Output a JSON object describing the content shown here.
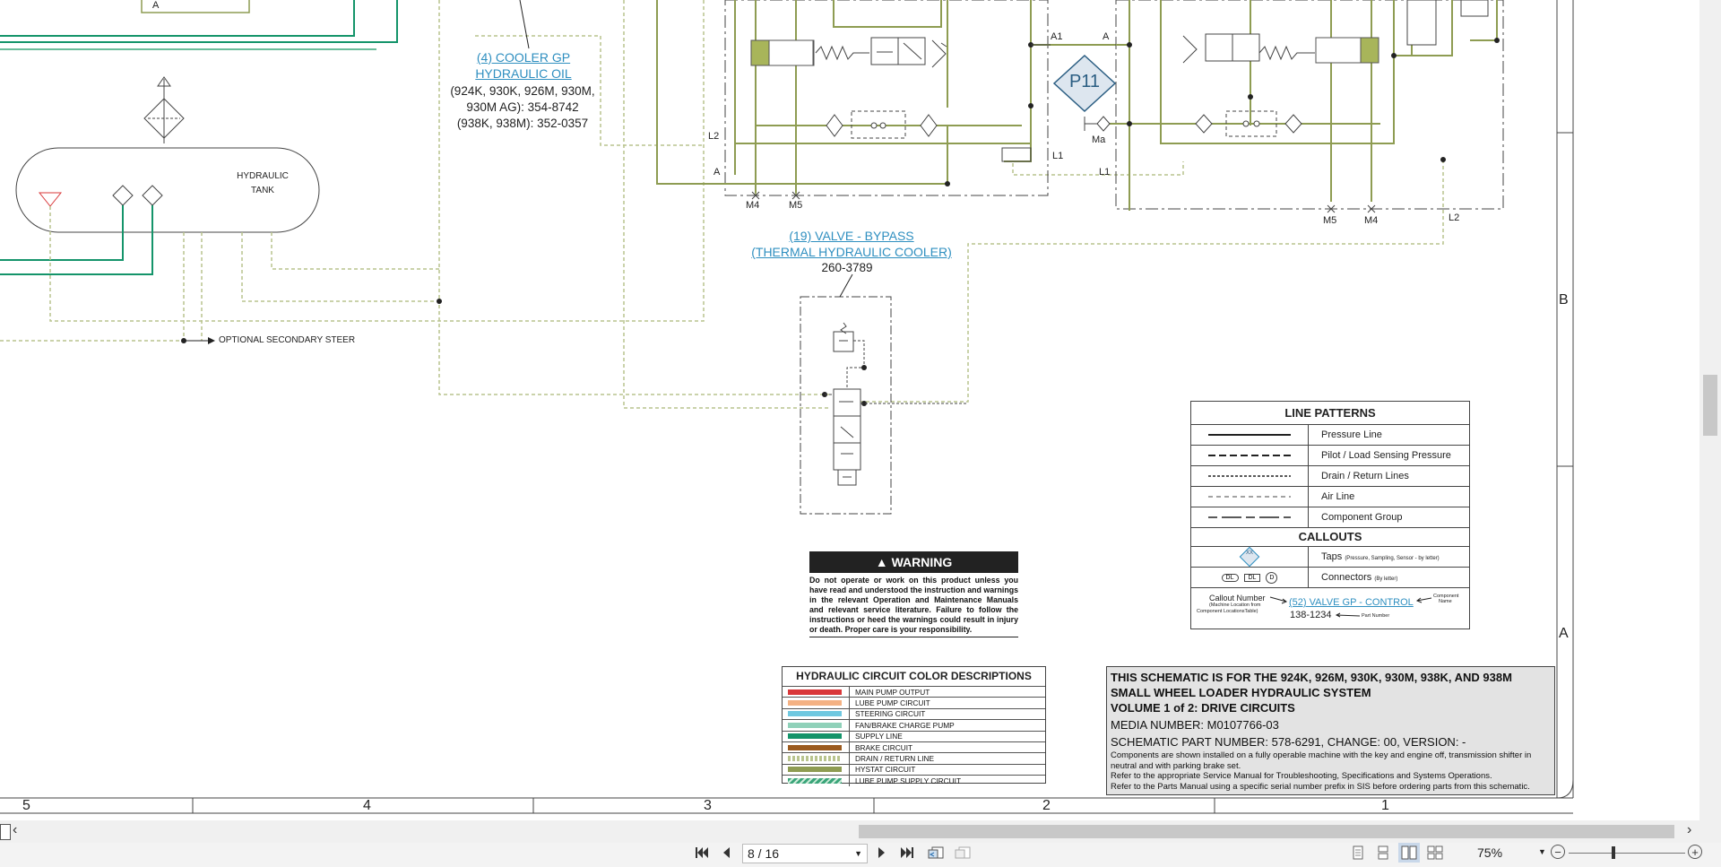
{
  "schematic": {
    "cooler": {
      "name_line1": "(4) COOLER GP",
      "name_line2": "HYDRAULIC OIL",
      "models_line1": "(924K, 930K, 926M, 930M,",
      "models_line2": "930M AG): 354-8742",
      "models_line3": "(938K, 938M): 352-0357"
    },
    "tank": {
      "line1": "HYDRAULIC",
      "line2": "TANK"
    },
    "secondary_steer": "OPTIONAL SECONDARY STEER",
    "bypass": {
      "name_line1": "(19) VALVE - BYPASS",
      "name_line2": "(THERMAL HYDRAULIC COOLER)",
      "part": "260-3789"
    },
    "port_labels": {
      "a_top_left": "A",
      "l2_left": "L2",
      "a_left": "A",
      "m4_left": "M4",
      "m5_left": "M5",
      "a1": "A1",
      "a_right": "A",
      "p11": "P11",
      "ma": "Ma",
      "l1_a": "L1",
      "l1_b": "L1",
      "m5_right": "M5",
      "m4_right": "M4",
      "l2_right": "L2"
    },
    "zones": {
      "b": "B",
      "a": "A"
    },
    "columns": [
      "5",
      "4",
      "3",
      "2",
      "1"
    ]
  },
  "warning": {
    "title": "WARNING",
    "body": "Do not operate or work on this product unless you have read and understood the instruction and warnings in the relevant Operation and Maintenance Manuals and relevant service literature. Failure to follow the instructions or heed the warnings could result in injury or death. Proper care is your responsibility."
  },
  "line_patterns": {
    "title": "LINE PATTERNS",
    "rows": [
      {
        "label": "Pressure Line"
      },
      {
        "label": "Pilot / Load Sensing Pressure"
      },
      {
        "label": "Drain / Return Lines"
      },
      {
        "label": "Air Line"
      },
      {
        "label": "Component Group"
      }
    ],
    "callouts_title": "CALLOUTS",
    "taps_label": "Taps",
    "taps_note": "(Pressure, Sampling, Sensor - by letter)",
    "connectors_label": "Connectors",
    "connectors_note": "(By letter)",
    "connector_dl1": "DL",
    "connector_dl2": "DL",
    "connector_d": "D",
    "tap_letters": "XX",
    "callout_number": "Callout Number",
    "callout_note_line1": "(Machine Location from",
    "callout_note_line2": "Component LocationsTable)",
    "example_link": "(52) VALVE GP - CONTROL",
    "component": "Component",
    "name": "Name",
    "example_part": "138-1234",
    "part_number": "Part Number"
  },
  "color_desc": {
    "title": "HYDRAULIC CIRCUIT COLOR DESCRIPTIONS",
    "rows": [
      {
        "label": "MAIN PUMP OUTPUT",
        "color": "#d9383a"
      },
      {
        "label": "LUBE PUMP CIRCUIT",
        "color": "#f4b183"
      },
      {
        "label": "STEERING CIRCUIT",
        "color": "#6fc8e0"
      },
      {
        "label": "FAN/BRAKE CHARGE PUMP",
        "color": "#8fd1b9"
      },
      {
        "label": "SUPPLY LINE",
        "color": "#14946a"
      },
      {
        "label": "BRAKE CIRCUIT",
        "color": "#9b5a1e"
      },
      {
        "label": "DRAIN / RETURN LINE",
        "color": "#b9c48e"
      },
      {
        "label": "HYSTAT CIRCUIT",
        "color": "#8e9c52"
      },
      {
        "label": "LUBE PUMP SUPPLY CIRCUIT",
        "color": "#3aa57a"
      }
    ]
  },
  "title_block": {
    "line1": "THIS SCHEMATIC IS FOR THE 924K, 926M, 930K, 930M, 938K, AND 938M",
    "line2": "SMALL WHEEL LOADER HYDRAULIC SYSTEM",
    "line3": "VOLUME 1 of 2: DRIVE CIRCUITS",
    "media": "MEDIA NUMBER: M0107766-03",
    "part": "SCHEMATIC PART NUMBER: 578-6291, CHANGE: 00, VERSION: -",
    "note1": "Components are shown installed on a fully operable machine with the key and engine off, transmission shifter in neutral and with parking brake set.",
    "note2": "Refer to the appropriate Service Manual for Troubleshooting, Specifications and Systems Operations.",
    "note3": "Refer to the Parts Manual using a specific serial number prefix in SIS before ordering parts from this schematic."
  },
  "viewer": {
    "page_value": "8 / 16",
    "zoom": "75%",
    "colors": {
      "toolbar": "#f3f3f3",
      "scroll_track": "#f0f0f0",
      "scroll_thumb": "#c8c8c8"
    }
  }
}
